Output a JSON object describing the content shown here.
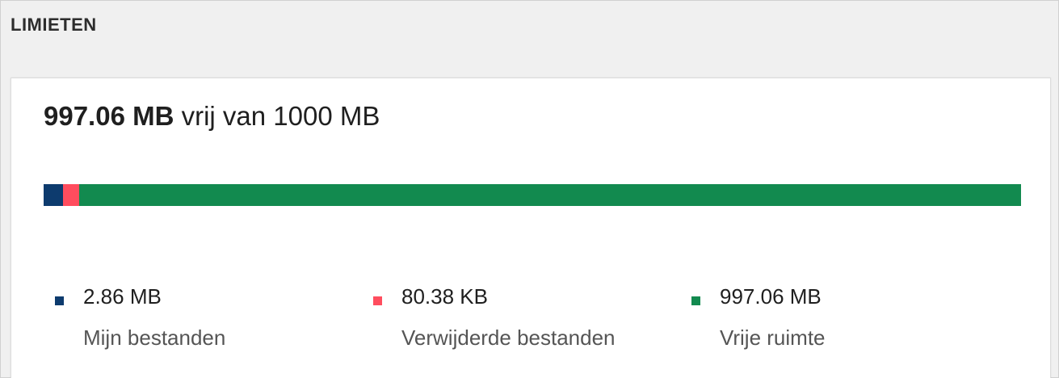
{
  "header": {
    "title": "LIMIETEN"
  },
  "summary": {
    "free_amount": "997.06 MB",
    "free_suffix": "vrij van 1000 MB"
  },
  "usage_bar": {
    "segments": [
      {
        "name": "mine",
        "fraction": 0.0196,
        "color": "#0d3b6e"
      },
      {
        "name": "deleted",
        "fraction": 0.0171,
        "color": "#ff4d5e"
      },
      {
        "name": "free",
        "fraction": 0.9633,
        "color": "#128a4f"
      }
    ]
  },
  "legend": [
    {
      "size": "2.86 MB",
      "label": "Mijn bestanden",
      "color": "#0d3b6e",
      "icon": "square-icon"
    },
    {
      "size": "80.38 KB",
      "label": "Verwijderde bestanden",
      "color": "#ff4d5e",
      "icon": "square-icon"
    },
    {
      "size": "997.06 MB",
      "label": "Vrije ruimte",
      "color": "#128a4f",
      "icon": "square-icon"
    }
  ]
}
